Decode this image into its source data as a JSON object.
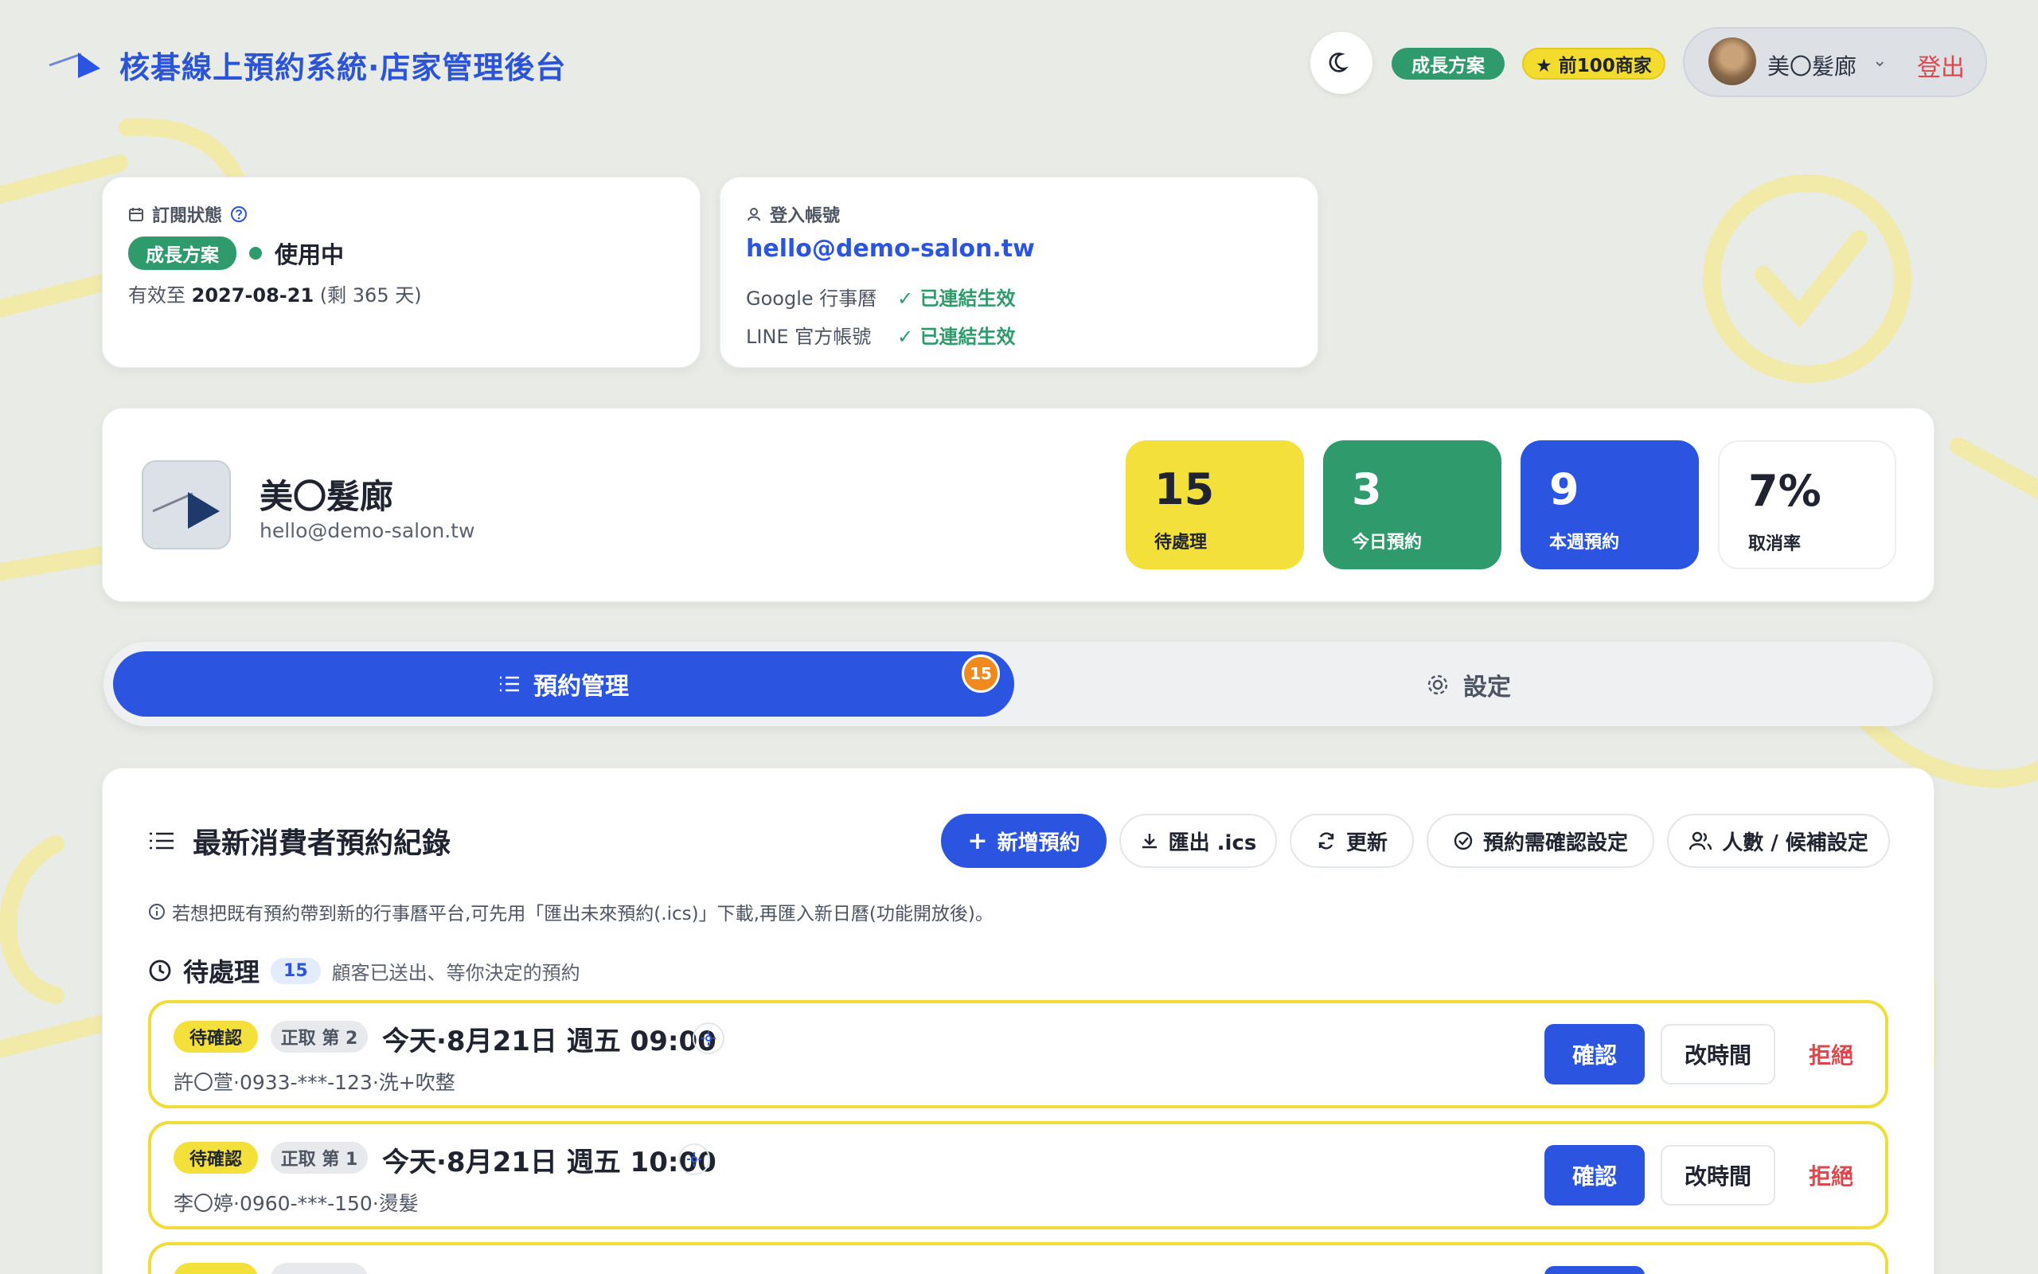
{
  "header": {
    "title": "核碁線上預約系統·店家管理後台",
    "plan_badge": "成長方案",
    "top100_badge": "★ 前100商家",
    "user_name": "美〇髮廊",
    "logout_label": "登出"
  },
  "subscription": {
    "label": "訂閱狀態",
    "plan": "成長方案",
    "status": "使用中",
    "valid_prefix": "有效至",
    "valid_date": "2027-08-21",
    "remaining": "(剩 365 天)"
  },
  "account": {
    "label": "登入帳號",
    "email": "hello@demo-salon.tw",
    "google_label": "Google 行事曆",
    "google_status": "已連結生效",
    "line_label": "LINE 官方帳號",
    "line_status": "已連結生效"
  },
  "shop": {
    "name": "美〇髮廊",
    "email": "hello@demo-salon.tw"
  },
  "stats": {
    "pending": {
      "value": "15",
      "label": "待處理"
    },
    "today": {
      "value": "3",
      "label": "今日預約"
    },
    "week": {
      "value": "9",
      "label": "本週預約"
    },
    "cancel": {
      "value": "7%",
      "label": "取消率"
    }
  },
  "tabs": {
    "bookings": "預約管理",
    "bookings_badge": "15",
    "settings": "設定"
  },
  "panel": {
    "title": "最新消費者預約紀錄",
    "buttons": {
      "add": "新增預約",
      "export": "匯出 .ics",
      "refresh": "更新",
      "confirm_settings": "預約需確認設定",
      "capacity": "人數 / 候補設定"
    },
    "info": "若想把既有預約帶到新的行事曆平台,可先用「匯出未來預約(.ics)」下載,再匯入新日曆(功能開放後)。",
    "pending_title": "待處理",
    "pending_count": "15",
    "pending_desc": "顧客已送出、等你決定的預約"
  },
  "bookings": [
    {
      "status": "待確認",
      "queue": "正取 第 2",
      "time": "今天·8月21日 週五 09:00",
      "customer": "許〇萱·0933-***-123·洗+吹整",
      "confirm": "確認",
      "reschedule": "改時間",
      "reject": "拒絕"
    },
    {
      "status": "待確認",
      "queue": "正取 第 1",
      "time": "今天·8月21日 週五 10:00",
      "customer": "李〇婷·0960-***-150·燙髮",
      "confirm": "確認",
      "reschedule": "改時間",
      "reject": "拒絕"
    }
  ],
  "colors": {
    "brand_blue": "#2b55e0",
    "green": "#2f9a6b",
    "yellow": "#f4e03a",
    "danger": "#e0474c"
  }
}
